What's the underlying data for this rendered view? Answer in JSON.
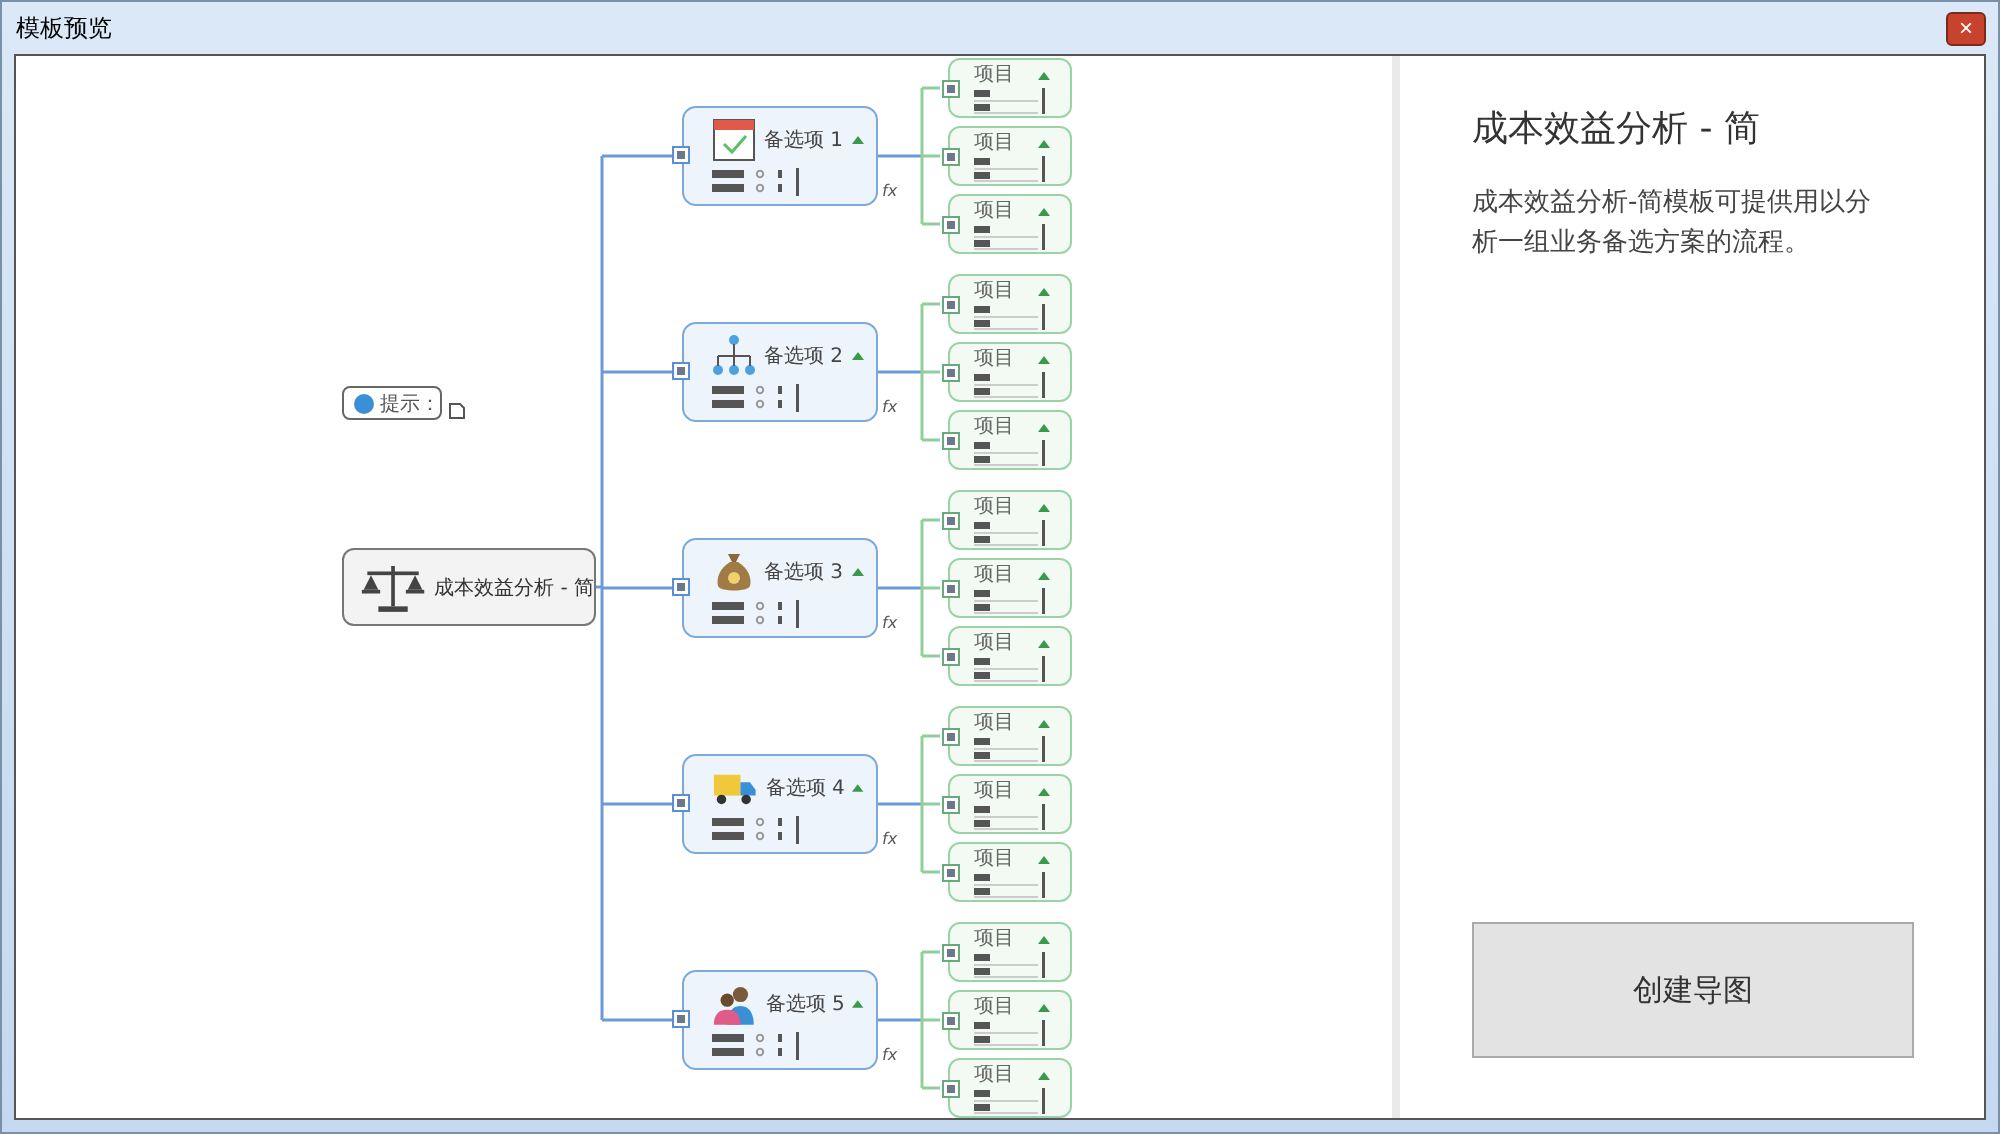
{
  "window": {
    "title": "模板预览",
    "close": "×"
  },
  "map": {
    "central": {
      "label": "成本效益分析 - 简"
    },
    "tip": {
      "label": "提示："
    },
    "options": [
      {
        "label": "备选项 1",
        "kind": "calendar",
        "formula": "fx",
        "items": [
          {
            "label": "项目"
          },
          {
            "label": "项目"
          },
          {
            "label": "项目"
          }
        ]
      },
      {
        "label": "备选项 2",
        "kind": "org-chart",
        "formula": "fx",
        "items": [
          {
            "label": "项目"
          },
          {
            "label": "项目"
          },
          {
            "label": "项目"
          }
        ]
      },
      {
        "label": "备选项 3",
        "kind": "money-bag",
        "formula": "fx",
        "items": [
          {
            "label": "项目"
          },
          {
            "label": "项目"
          },
          {
            "label": "项目"
          }
        ]
      },
      {
        "label": "备选项 4",
        "kind": "truck",
        "formula": "fx",
        "items": [
          {
            "label": "项目"
          },
          {
            "label": "项目"
          },
          {
            "label": "项目"
          }
        ]
      },
      {
        "label": "备选项 5",
        "kind": "people",
        "formula": "fx",
        "items": [
          {
            "label": "项目"
          },
          {
            "label": "项目"
          },
          {
            "label": "项目"
          }
        ]
      }
    ]
  },
  "panel": {
    "title": "成本效益分析 - 简",
    "description": "成本效益分析-简模板可提供用以分析一组业务备选方案的流程。",
    "button": "创建导图"
  }
}
